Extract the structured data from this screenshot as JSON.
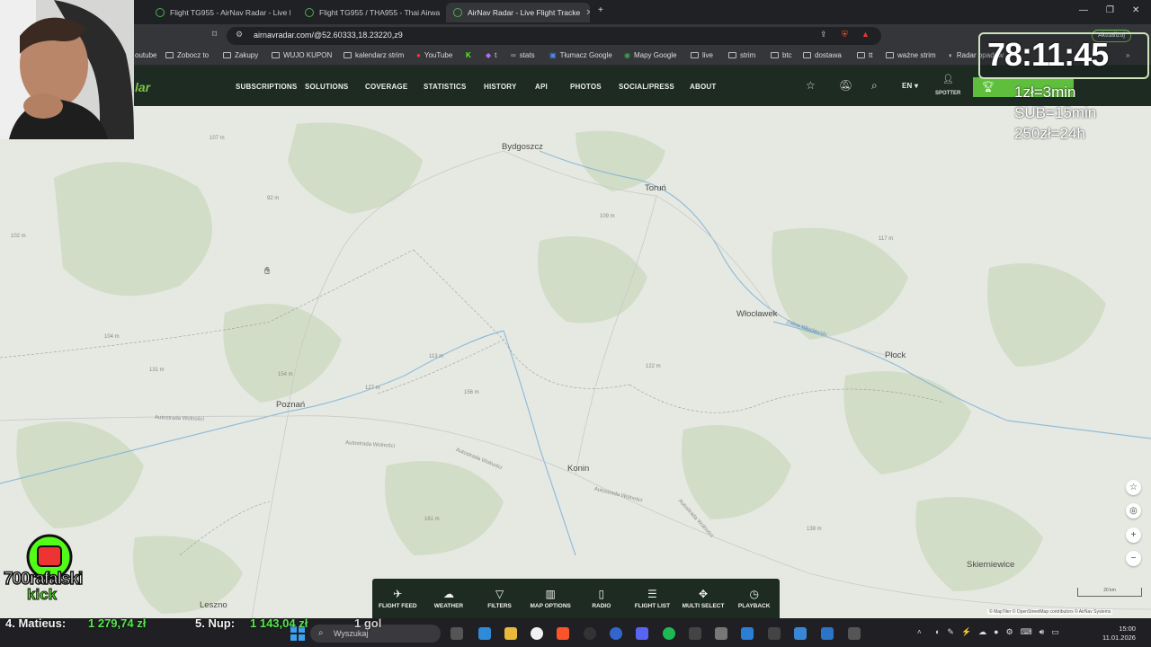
{
  "browser": {
    "tabs": [
      {
        "title": "Flight TG955 - AirNav Radar - Live Fl",
        "active": false
      },
      {
        "title": "Flight TG955 / THA955 - Thai Airways",
        "active": false
      },
      {
        "title": "AirNav Radar - Live Flight Tracke",
        "active": true
      }
    ],
    "url": "airnavradar.com/@52.60333,18.23220,z9",
    "bookmarks": [
      "outube",
      "Zobocz to",
      "Zakupy",
      "WUJO KUPON",
      "kalendarz strim",
      "YouTube",
      "t",
      "stats",
      "Tłumacz Google",
      "Mapy Google",
      "live",
      "strim",
      "btc",
      "dostawa",
      "tt",
      "ważne strim",
      "Radar opadów"
    ],
    "update_label": "Aktualizuj"
  },
  "nav": {
    "logo_text": "lar",
    "links": [
      "SUBSCRIPTIONS",
      "SOLUTIONS",
      "COVERAGE",
      "STATISTICS",
      "HISTORY",
      "API",
      "PHOTOS",
      "SOCIAL/PRESS",
      "ABOUT"
    ],
    "language": "EN",
    "spotter_label": "SPOTTER"
  },
  "map": {
    "cities": [
      {
        "name": "Bydgoszcz"
      },
      {
        "name": "Toruń"
      },
      {
        "name": "Włocławek"
      },
      {
        "name": "Płock"
      },
      {
        "name": "Poznań"
      },
      {
        "name": "Konin"
      },
      {
        "name": "Leszno"
      },
      {
        "name": "Skierniewice"
      }
    ],
    "river_label": "Zalew Włocławski",
    "road_labels": [
      "Autostrada Wolności",
      "Autostrada Wolności",
      "Autostrada Wolności",
      "Autostrada Wolności",
      "Autostrada Wolności"
    ],
    "elevations": [
      "107 m",
      "102 m",
      "92 m",
      "109 m",
      "117 m",
      "104 m",
      "131 m",
      "113 m",
      "154 m",
      "127 m",
      "156 m",
      "122 m",
      "161 m",
      "138 m"
    ],
    "attribution": "© MapTiler © OpenStreetMap contributors © AirNav Systems",
    "scale": "20 km"
  },
  "toolbar": {
    "items": [
      {
        "label": "FLIGHT FEED",
        "icon": "plane-icon"
      },
      {
        "label": "WEATHER",
        "icon": "cloud-icon"
      },
      {
        "label": "FILTERS",
        "icon": "filter-icon"
      },
      {
        "label": "MAP OPTIONS",
        "icon": "map-icon"
      },
      {
        "label": "RADIO",
        "icon": "radio-icon"
      },
      {
        "label": "FLIGHT LIST",
        "icon": "list-icon"
      },
      {
        "label": "MULTI SELECT",
        "icon": "multi-select-icon"
      },
      {
        "label": "PLAYBACK",
        "icon": "playback-icon"
      }
    ]
  },
  "stream": {
    "timer": "78:11:45",
    "rates": [
      "1zł=3min",
      "SUB=15min",
      "250zł=24h"
    ],
    "channel": "700rafalski",
    "platform": "kick",
    "ticker": [
      {
        "text": "4. Matieus:",
        "color": "#f2f2f2"
      },
      {
        "text": "1 279,74 zł",
        "color": "#54e84c"
      },
      {
        "text": "5. Nup:",
        "color": "#f2f2f2"
      },
      {
        "text": "1 143,04 zł",
        "color": "#54e84c"
      },
      {
        "text": "1 gol",
        "color": "#f2f2f2"
      }
    ]
  },
  "taskbar": {
    "search_placeholder": "Wyszukaj",
    "time": "15:00",
    "date": "11.01.2026"
  }
}
